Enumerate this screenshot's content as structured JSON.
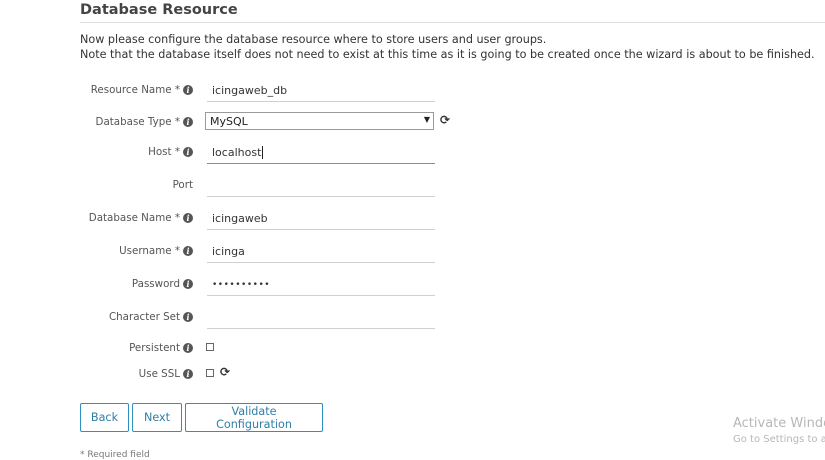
{
  "page": {
    "title": "Database Resource",
    "intro_line1": "Now please configure the database resource where to store users and user groups.",
    "intro_line2": "Note that the database itself does not need to exist at this time as it is going to be created once the wizard is about to be finished."
  },
  "form": {
    "resource_name": {
      "label": "Resource Name *",
      "value": "icingaweb_db"
    },
    "database_type": {
      "label": "Database Type *",
      "value": "MySQL"
    },
    "host": {
      "label": "Host *",
      "value": "localhost"
    },
    "port": {
      "label": "Port",
      "value": ""
    },
    "database_name": {
      "label": "Database Name *",
      "value": "icingaweb"
    },
    "username": {
      "label": "Username *",
      "value": "icinga"
    },
    "password": {
      "label": "Password",
      "value": "••••••••••"
    },
    "character_set": {
      "label": "Character Set",
      "value": ""
    },
    "persistent": {
      "label": "Persistent",
      "checked": false
    },
    "use_ssl": {
      "label": "Use SSL",
      "checked": false
    }
  },
  "buttons": {
    "back": "Back",
    "next": "Next",
    "validate": "Validate Configuration"
  },
  "footer": {
    "required_note": "* Required field"
  },
  "overlay": {
    "activate_line1": "Activate Windo",
    "activate_line2": "Go to Settings to ac"
  },
  "icons": {
    "info": "info-icon",
    "refresh": "refresh-icon",
    "caret": "dropdown-caret-icon"
  },
  "colors": {
    "accent": "#2f8fbf",
    "active_border": "#49a3c7"
  }
}
